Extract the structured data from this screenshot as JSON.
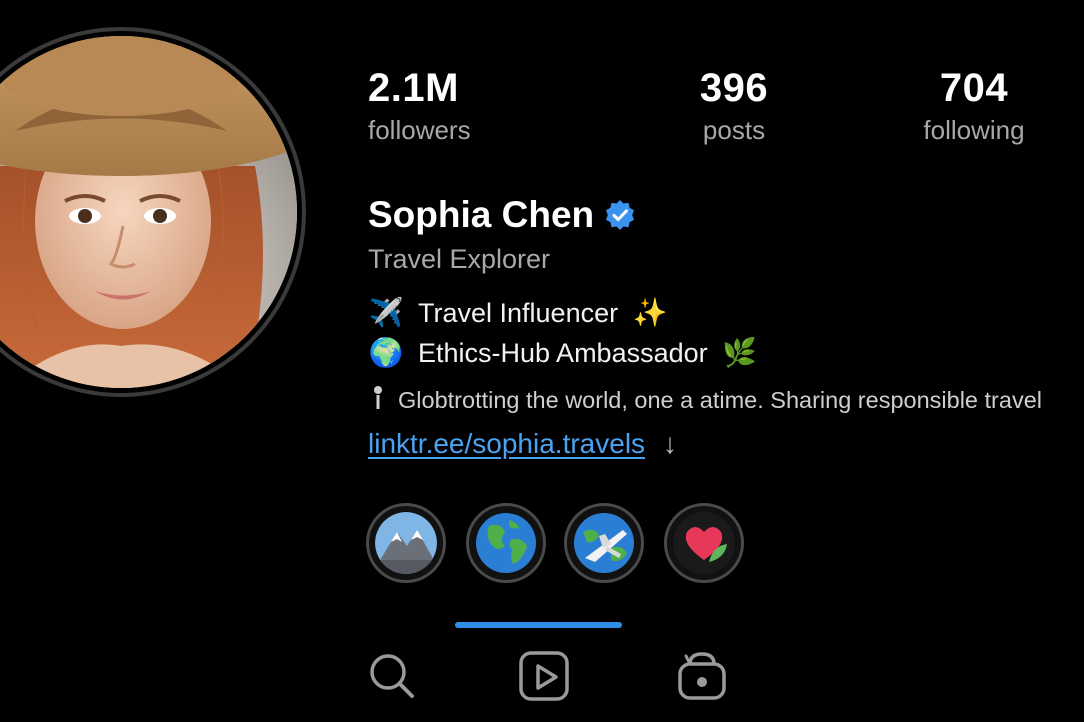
{
  "profile": {
    "name": "Sophia Chen",
    "subtitle": "Travel Explorer",
    "verified": true
  },
  "stats": [
    {
      "value": "2.1M",
      "label": "followers"
    },
    {
      "value": "396",
      "label": "posts"
    },
    {
      "value": "704",
      "label": "following"
    }
  ],
  "bio": {
    "line1": {
      "icon": "✈️",
      "text": "Travel Influencer",
      "trail": "✨"
    },
    "line2": {
      "icon": "🌍",
      "text": "Ethics-Hub Ambassador",
      "trail": "🌿"
    },
    "line3": {
      "icon": "pin-icon",
      "text": "Globtrotting the world, one a atime. Sharing responsible travel"
    },
    "link": "linktr.ee/sophia.travels"
  },
  "highlights": [
    {
      "icon": "mountain-icon"
    },
    {
      "icon": "globe-icon"
    },
    {
      "icon": "plane-globe-icon"
    },
    {
      "icon": "heart-leaf-icon"
    }
  ],
  "tabs": [
    {
      "icon": "search-icon"
    },
    {
      "icon": "reels-icon"
    },
    {
      "icon": "shop-bag-icon"
    }
  ],
  "colors": {
    "accent": "#2f8fe6",
    "link": "#4aa3f0",
    "muted": "#a8a8a8",
    "verified": "#3b93f0"
  }
}
